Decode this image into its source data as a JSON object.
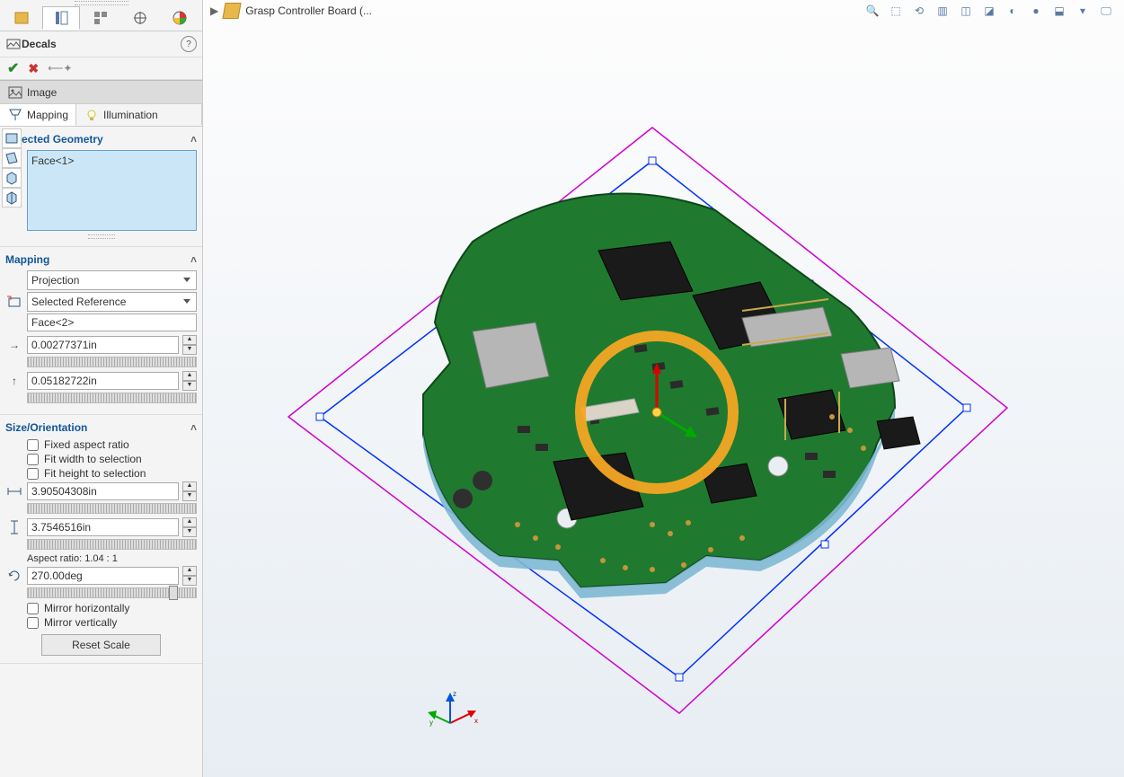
{
  "breadcrumb": {
    "part_name": "Grasp Controller Board  (..."
  },
  "panel": {
    "title": "Decals",
    "image_tab": "Image",
    "sub_tabs": {
      "mapping": "Mapping",
      "illumination": "Illumination"
    }
  },
  "selected_geometry": {
    "title": "Selected Geometry",
    "items": [
      "Face<1>"
    ]
  },
  "mapping": {
    "title": "Mapping",
    "type": "Projection",
    "ref_label": "Selected Reference",
    "ref_value": "Face<2>",
    "x_offset": "0.00277371in",
    "y_offset": "0.05182722in"
  },
  "size": {
    "title": "Size/Orientation",
    "fixed_aspect": "Fixed aspect ratio",
    "fit_width": "Fit width to selection",
    "fit_height": "Fit height to selection",
    "width": "3.90504308in",
    "height": "3.7546516in",
    "aspect_text": "Aspect ratio: 1.04 : 1",
    "rotation": "270.00deg",
    "mirror_h": "Mirror horizontally",
    "mirror_v": "Mirror vertically",
    "reset": "Reset Scale"
  }
}
